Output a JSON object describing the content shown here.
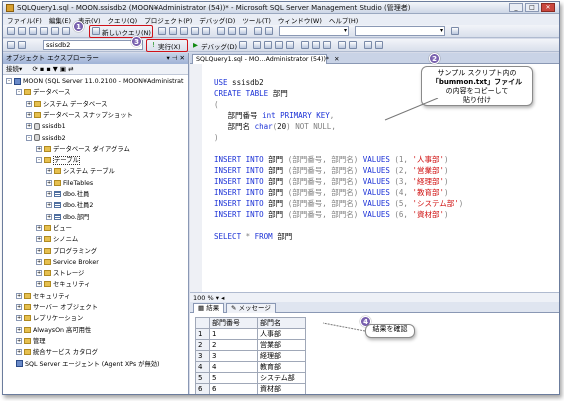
{
  "window": {
    "title": "SQLQuery1.sql - MOON.ssisdb2 (MOON¥Administrator (54))* - Microsoft SQL Server Management Studio (管理者)"
  },
  "menu": [
    "ファイル(F)",
    "編集(E)",
    "表示(V)",
    "クエリ(Q)",
    "プロジェクト(P)",
    "デバッグ(D)",
    "ツール(T)",
    "ウィンドウ(W)",
    "ヘルプ(H)"
  ],
  "toolbar": {
    "new_query": "新しいクエリ(N)",
    "database": "ssisdb2",
    "execute": "実行(X)",
    "debug": "デバッグ(D)"
  },
  "object_explorer": {
    "title": "オブジェクト エクスプローラー",
    "connect": "接続▾",
    "tree": [
      {
        "label": "MOON (SQL Server 11.0.2100 - MOON¥Administrat",
        "level": 0,
        "exp": "-",
        "icon": "sv"
      },
      {
        "label": "データベース",
        "level": 1,
        "exp": "-",
        "icon": "fi"
      },
      {
        "label": "システム データベース",
        "level": 2,
        "exp": "+",
        "icon": "fi"
      },
      {
        "label": "データベース スナップショット",
        "level": 2,
        "exp": "+",
        "icon": "fi"
      },
      {
        "label": "ssisdb1",
        "level": 2,
        "exp": "+",
        "icon": "db"
      },
      {
        "label": "ssisdb2",
        "level": 2,
        "exp": "-",
        "icon": "db"
      },
      {
        "label": "データベース ダイアグラム",
        "level": 3,
        "exp": "+",
        "icon": "fi"
      },
      {
        "label": "テーブル",
        "level": 3,
        "exp": "-",
        "icon": "fi",
        "sel": true
      },
      {
        "label": "システム テーブル",
        "level": 4,
        "exp": "+",
        "icon": "fi"
      },
      {
        "label": "FileTables",
        "level": 4,
        "exp": "+",
        "icon": "fi"
      },
      {
        "label": "dbo.社員",
        "level": 4,
        "exp": "+",
        "icon": "tbl"
      },
      {
        "label": "dbo.社員2",
        "level": 4,
        "exp": "+",
        "icon": "tbl"
      },
      {
        "label": "dbo.部門",
        "level": 4,
        "exp": "+",
        "icon": "tbl"
      },
      {
        "label": "ビュー",
        "level": 3,
        "exp": "+",
        "icon": "fi"
      },
      {
        "label": "シノニム",
        "level": 3,
        "exp": "+",
        "icon": "fi"
      },
      {
        "label": "プログラミング",
        "level": 3,
        "exp": "+",
        "icon": "fi"
      },
      {
        "label": "Service Broker",
        "level": 3,
        "exp": "+",
        "icon": "fi"
      },
      {
        "label": "ストレージ",
        "level": 3,
        "exp": "+",
        "icon": "fi"
      },
      {
        "label": "セキュリティ",
        "level": 3,
        "exp": "+",
        "icon": "fi"
      },
      {
        "label": "セキュリティ",
        "level": 1,
        "exp": "+",
        "icon": "fi"
      },
      {
        "label": "サーバー オブジェクト",
        "level": 1,
        "exp": "+",
        "icon": "fi"
      },
      {
        "label": "レプリケーション",
        "level": 1,
        "exp": "+",
        "icon": "fi"
      },
      {
        "label": "AlwaysOn 高可用性",
        "level": 1,
        "exp": "+",
        "icon": "fi"
      },
      {
        "label": "管理",
        "level": 1,
        "exp": "+",
        "icon": "fi"
      },
      {
        "label": "統合サービス カタログ",
        "level": 1,
        "exp": "+",
        "icon": "fi"
      },
      {
        "label": "SQL Server エージェント (Agent XPs が無効)",
        "level": 1,
        "exp": "",
        "icon": "sv"
      }
    ]
  },
  "editor": {
    "tab": "SQLQuery1.sql - MO…Administrator (54))*",
    "lines": [
      [
        [
          "kw",
          "USE"
        ],
        [
          "bk",
          " ssisdb2"
        ]
      ],
      [
        [
          "kw",
          "CREATE TABLE"
        ],
        [
          "bk",
          " 部門"
        ]
      ],
      [
        [
          "gr",
          "("
        ]
      ],
      [
        [
          "bk",
          "   部門番号 "
        ],
        [
          "kw",
          "int PRIMARY KEY"
        ],
        [
          "gr",
          ","
        ]
      ],
      [
        [
          "bk",
          "   部門名 "
        ],
        [
          "kw",
          "char"
        ],
        [
          "gr",
          "("
        ],
        [
          "bk",
          "20"
        ],
        [
          "gr",
          ") "
        ],
        [
          "gr",
          "NOT NULL"
        ],
        [
          "gr",
          ","
        ]
      ],
      [
        [
          "gr",
          ")"
        ]
      ],
      [
        [
          "bk",
          ""
        ]
      ],
      [
        [
          "kw",
          "INSERT INTO"
        ],
        [
          "bk",
          " 部門 "
        ],
        [
          "gr",
          "(部門番号, 部門名) "
        ],
        [
          "kw",
          "VALUES"
        ],
        [
          "gr",
          " (1, "
        ],
        [
          "str",
          "'人事部'"
        ],
        [
          "gr",
          ")"
        ]
      ],
      [
        [
          "kw",
          "INSERT INTO"
        ],
        [
          "bk",
          " 部門 "
        ],
        [
          "gr",
          "(部門番号, 部門名) "
        ],
        [
          "kw",
          "VALUES"
        ],
        [
          "gr",
          " (2, "
        ],
        [
          "str",
          "'営業部'"
        ],
        [
          "gr",
          ")"
        ]
      ],
      [
        [
          "kw",
          "INSERT INTO"
        ],
        [
          "bk",
          " 部門 "
        ],
        [
          "gr",
          "(部門番号, 部門名) "
        ],
        [
          "kw",
          "VALUES"
        ],
        [
          "gr",
          " (3, "
        ],
        [
          "str",
          "'経理部'"
        ],
        [
          "gr",
          ")"
        ]
      ],
      [
        [
          "kw",
          "INSERT INTO"
        ],
        [
          "bk",
          " 部門 "
        ],
        [
          "gr",
          "(部門番号, 部門名) "
        ],
        [
          "kw",
          "VALUES"
        ],
        [
          "gr",
          " (4, "
        ],
        [
          "str",
          "'教育部'"
        ],
        [
          "gr",
          ")"
        ]
      ],
      [
        [
          "kw",
          "INSERT INTO"
        ],
        [
          "bk",
          " 部門 "
        ],
        [
          "gr",
          "(部門番号, 部門名) "
        ],
        [
          "kw",
          "VALUES"
        ],
        [
          "gr",
          " (5, "
        ],
        [
          "str",
          "'システム部'"
        ],
        [
          "gr",
          ")"
        ]
      ],
      [
        [
          "kw",
          "INSERT INTO"
        ],
        [
          "bk",
          " 部門 "
        ],
        [
          "gr",
          "(部門番号, 部門名) "
        ],
        [
          "kw",
          "VALUES"
        ],
        [
          "gr",
          " (6, "
        ],
        [
          "str",
          "'資材部'"
        ],
        [
          "gr",
          ")"
        ]
      ],
      [
        [
          "bk",
          ""
        ]
      ],
      [
        [
          "kw",
          "SELECT"
        ],
        [
          "gr",
          " * "
        ],
        [
          "kw",
          "FROM"
        ],
        [
          "bk",
          " 部門"
        ]
      ]
    ],
    "zoom": "100 %"
  },
  "results": {
    "tabs": [
      "結果",
      "メッセージ"
    ],
    "columns": [
      "部門番号",
      "部門名"
    ],
    "rows": [
      [
        "1",
        "人事部"
      ],
      [
        "2",
        "営業部"
      ],
      [
        "3",
        "経理部"
      ],
      [
        "4",
        "教育部"
      ],
      [
        "5",
        "システム部"
      ],
      [
        "6",
        "資材部"
      ]
    ]
  },
  "annotations": {
    "badges": [
      "1",
      "2",
      "3",
      "4"
    ],
    "callout2": [
      "サンプル スクリプト内の",
      "「bummon.txt」ファイル",
      "の内容をコピーして",
      "貼り付け"
    ],
    "callout4": "結果を確認"
  }
}
